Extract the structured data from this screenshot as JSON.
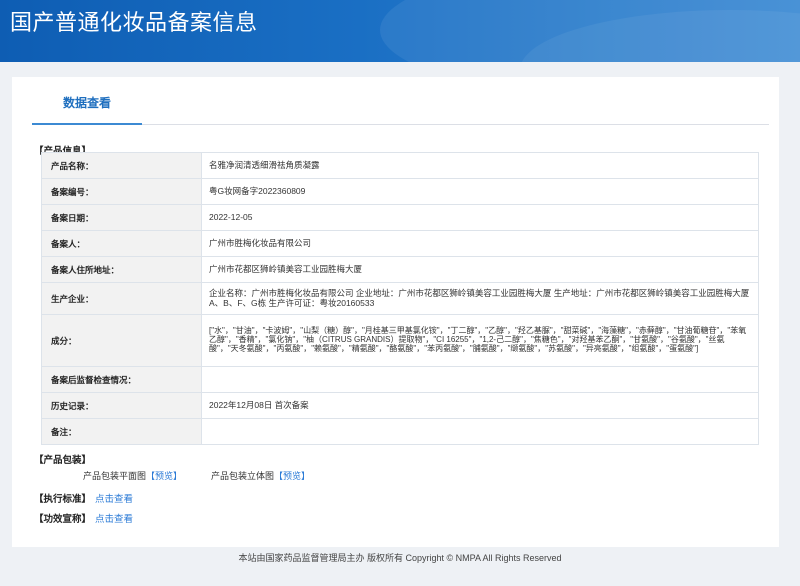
{
  "header": {
    "title": "国产普通化妆品备案信息"
  },
  "tabs": [
    {
      "label": "数据查看"
    }
  ],
  "product_section": {
    "title": "【产品信息】",
    "rows": [
      {
        "key": "产品名称：",
        "value": "名雅净润清透细滑祛角质凝露"
      },
      {
        "key": "备案编号：",
        "value": "粤G妆网备字2022360809"
      },
      {
        "key": "备案日期：",
        "value": "2022-12-05"
      },
      {
        "key": "备案人：",
        "value": "广州市胜梅化妆品有限公司"
      },
      {
        "key": "备案人住所地址：",
        "value": "广州市花都区狮岭镇美容工业园胜梅大厦"
      },
      {
        "key": "生产企业：",
        "value": "企业名称：广州市胜梅化妆品有限公司 企业地址：广州市花都区狮岭镇美容工业园胜梅大厦 生产地址：广州市花都区狮岭镇美容工业园胜梅大厦A、B、F、G栋 生产许可证：粤妆20160533"
      },
      {
        "key": "成分：",
        "value": "[\"水\"，\"甘油\"，\"卡波姆\"，\"山梨（糖）醇\"，\"月桂基三甲基氯化铵\"，\"丁二醇\"，\"乙醇\"，\"羟乙基脲\"，\"甜菜碱\"，\"海藻糖\"，\"赤藓醇\"，\"甘油葡糖苷\"，\"苯氧乙醇\"，\"香精\"，\"氯化钠\"，\"柚（CITRUS GRANDIS）提取物\"，\"CI 16255\"，\"1,2-己二醇\"，\"焦糖色\"，\"对羟基苯乙酮\"，\"甘氨酸\"，\"谷氨酸\"，\"丝氨酸\"，\"天冬氨酸\"，\"丙氨酸\"，\"赖氨酸\"，\"精氨酸\"，\"酪氨酸\"，\"苯丙氨酸\"，\"脯氨酸\"，\"缬氨酸\"，\"苏氨酸\"，\"异亮氨酸\"，\"组氨酸\"，\"蛋氨酸\"]"
      },
      {
        "key": "备案后监督检查情况：",
        "value": ""
      },
      {
        "key": "历史记录：",
        "value": "2022年12月08日 首次备案"
      },
      {
        "key": "备注：",
        "value": ""
      }
    ]
  },
  "packaging": {
    "title": "【产品包装】",
    "flat_label": "产品包装平面图",
    "flat_link": "【预览】",
    "stereo_label": "产品包装立体图",
    "stereo_link": "【预览】"
  },
  "standard": {
    "title": "【执行标准】",
    "link": "点击查看"
  },
  "efficacy": {
    "title": "【功效宣称】",
    "link": "点击查看"
  },
  "footer": {
    "text": "本站由国家药品监督管理局主办 版权所有 Copyright © NMPA All Rights Reserved"
  }
}
